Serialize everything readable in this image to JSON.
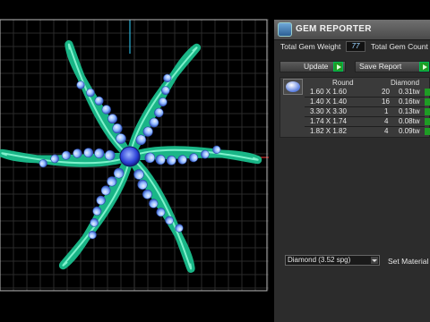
{
  "panel": {
    "title": "GEM REPORTER",
    "total_weight_label": "Total Gem Weight",
    "total_weight_value": "77",
    "total_count_label": "Total Gem Count",
    "update_label": "Update",
    "save_report_label": "Save Report",
    "table": {
      "headers": [
        "Round",
        "Diamond"
      ],
      "rows": [
        {
          "size": "1.60 X 1.60",
          "count": "20",
          "weight": "0.31tw"
        },
        {
          "size": "1.40 X 1.40",
          "count": "16",
          "weight": "0.16tw"
        },
        {
          "size": "3.30 X 3.30",
          "count": "1",
          "weight": "0.13tw"
        },
        {
          "size": "1.74 X 1.74",
          "count": "4",
          "weight": "0.08tw"
        },
        {
          "size": "1.82 X 1.82",
          "count": "4",
          "weight": "0.09tw"
        }
      ]
    },
    "material_select": "Diamond    (3.52 spg)",
    "set_material_label": "Set Material"
  },
  "colors": {
    "accent_green": "#1e9d24",
    "model_green": "#19a07a",
    "gem_blue": "#8fb8ff",
    "panel_bg": "#2c2c2c"
  }
}
